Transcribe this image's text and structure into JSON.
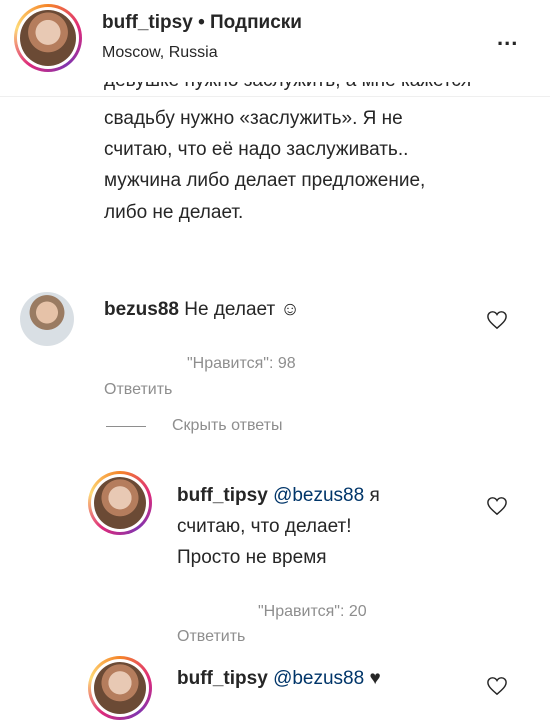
{
  "header": {
    "username": "buff_tipsy",
    "separator": "•",
    "follow_label": "Подписки",
    "location": "Moscow, Russia",
    "more_label": "..."
  },
  "caption": {
    "cut_line": "девушке нужно заслужить, а мне кажется",
    "lines": [
      "свадьбу нужно «заслужить». Я не",
      "считаю, что её надо заслуживать..",
      "мужчина либо делает предложение,",
      "либо не делает."
    ]
  },
  "comments": [
    {
      "username": "bezus88",
      "text": "Не делает ☺",
      "likes_label": "\"Нравится\": 98",
      "reply_label": "Ответить",
      "toggle_label": "Скрыть ответы"
    }
  ],
  "replies": [
    {
      "username": "buff_tipsy",
      "mention": "@bezus88",
      "text_first": "я",
      "text_lines": [
        "считаю, что делает!",
        "Просто не время"
      ],
      "likes_label": "\"Нравится\": 20",
      "reply_label": "Ответить"
    },
    {
      "username": "buff_tipsy",
      "mention": "@bezus88",
      "text_first": "♥"
    }
  ]
}
